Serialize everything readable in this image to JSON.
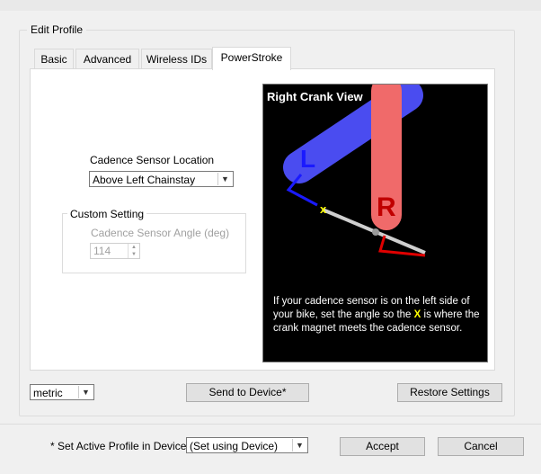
{
  "dialog": {
    "group_title": "Edit Profile"
  },
  "tabs": [
    {
      "label": "Basic"
    },
    {
      "label": "Advanced"
    },
    {
      "label": "Wireless IDs"
    },
    {
      "label": "PowerStroke",
      "active": true
    }
  ],
  "sensor": {
    "location_label": "Cadence Sensor Location",
    "location_value": "Above Left Chainstay"
  },
  "custom": {
    "group_title": "Custom Setting",
    "angle_label": "Cadence Sensor Angle (deg)",
    "angle_value": "114"
  },
  "crank_view": {
    "title": "Right Crank View",
    "left_letter": "L",
    "right_letter": "R",
    "marker": "x",
    "note_before": "If your cadence sensor is on the left side of your bike, set the angle so the",
    "note_mark": "X",
    "note_after": "is where the crank magnet meets the cadence sensor.",
    "colors": {
      "left_crank": "#4a4cf0",
      "right_crank": "#f06a6a",
      "left_lines": "#1a1aff",
      "right_lines": "#e00000",
      "marker": "#ffff00"
    }
  },
  "footer": {
    "units_value": "metric",
    "send_button": "Send to Device*",
    "restore_button": "Restore Settings",
    "active_profile_label": "* Set Active Profile in Device",
    "active_profile_value": "(Set using Device)",
    "accept_button": "Accept",
    "cancel_button": "Cancel"
  }
}
